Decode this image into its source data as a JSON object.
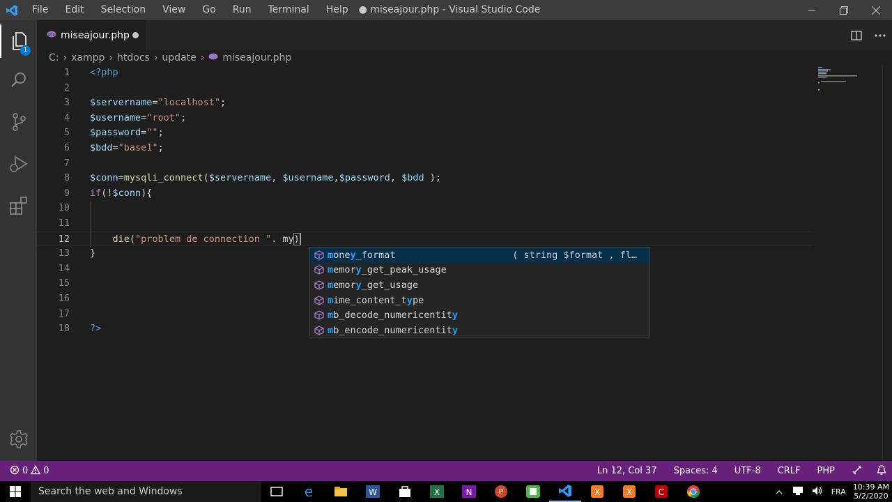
{
  "titlebar": {
    "menu": [
      "File",
      "Edit",
      "Selection",
      "View",
      "Go",
      "Run",
      "Terminal",
      "Help"
    ],
    "title": "● miseajour.php - Visual Studio Code"
  },
  "activity": {
    "explorer_badge": "1"
  },
  "tab": {
    "label": "miseajour.php"
  },
  "breadcrumb": [
    "C:",
    "xampp",
    "htdocs",
    "update",
    "miseajour.php"
  ],
  "editor": {
    "line_numbers": [
      "1",
      "2",
      "3",
      "4",
      "5",
      "6",
      "7",
      "8",
      "9",
      "10",
      "11",
      "12",
      "13",
      "14",
      "15",
      "16",
      "17",
      "18"
    ]
  },
  "suggest": {
    "items": [
      {
        "match": "m",
        "mid": "one",
        "m2": "y",
        "rest": "_format",
        "detail": "( string $format , fl…"
      },
      {
        "match": "m",
        "mid": "emor",
        "m2": "y",
        "rest": "_get_peak_usage",
        "detail": ""
      },
      {
        "match": "m",
        "mid": "emor",
        "m2": "y",
        "rest": "_get_usage",
        "detail": ""
      },
      {
        "match": "m",
        "mid": "ime_content_t",
        "m2": "y",
        "rest": "pe",
        "detail": ""
      },
      {
        "match": "m",
        "mid": "b_decode_numericentit",
        "m2": "y",
        "rest": "",
        "detail": ""
      },
      {
        "match": "m",
        "mid": "b_encode_numericentit",
        "m2": "y",
        "rest": "",
        "detail": ""
      }
    ]
  },
  "statusbar": {
    "errors": "0",
    "warnings": "0",
    "position": "Ln 12, Col 37",
    "spaces": "Spaces: 4",
    "encoding": "UTF-8",
    "eol": "CRLF",
    "language": "PHP"
  },
  "taskbar": {
    "search_placeholder": "Search the web and Windows",
    "lang": "FRA",
    "time": "10:39 AM",
    "date": "5/2/2020"
  },
  "colors": {
    "statusbar": "#68217a",
    "accent": "#007acc"
  }
}
